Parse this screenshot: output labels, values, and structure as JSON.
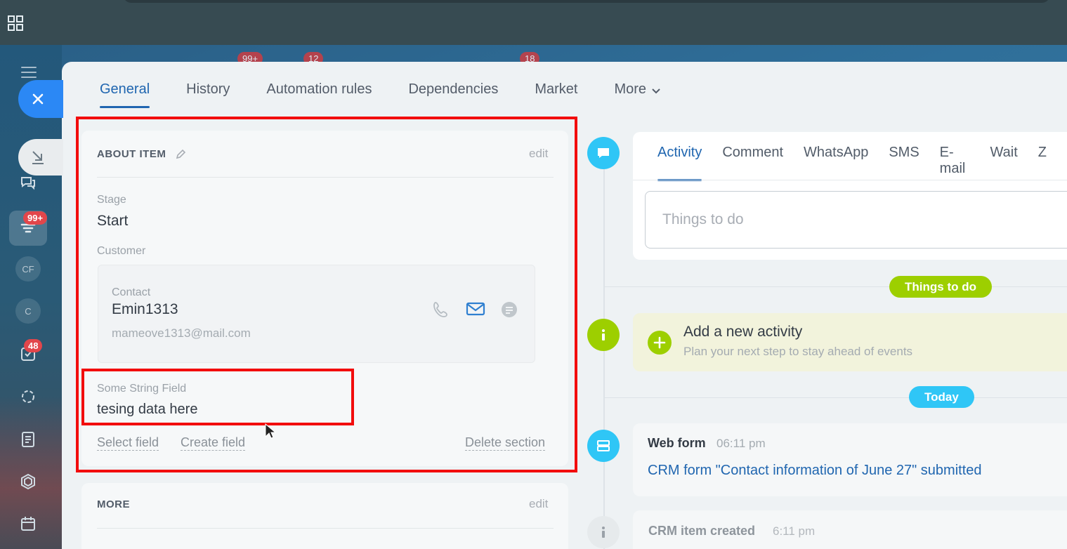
{
  "top_badges": [
    "99+",
    "12",
    "18"
  ],
  "leftnav": {
    "avatars": [
      "CF",
      "C"
    ],
    "badges": {
      "feed": "99+",
      "tasks": "48"
    }
  },
  "tabs": {
    "general": "General",
    "history": "History",
    "automation": "Automation rules",
    "dependencies": "Dependencies",
    "market": "Market",
    "more": "More"
  },
  "about": {
    "title": "ABOUT ITEM",
    "edit": "edit",
    "stage_label": "Stage",
    "stage_value": "Start",
    "customer_label": "Customer",
    "contact_label": "Contact",
    "contact_name": "Emin1313",
    "contact_email": "mameove1313@mail.com",
    "string_field_label": "Some String Field",
    "string_field_value": "tesing data here",
    "select_field": "Select field",
    "create_field": "Create field",
    "delete_section": "Delete section"
  },
  "more_section": {
    "title": "MORE",
    "edit": "edit"
  },
  "editor": {
    "tabs": [
      "Activity",
      "Comment",
      "WhatsApp",
      "SMS",
      "E-mail",
      "Wait",
      "Z"
    ],
    "placeholder": "Things to do"
  },
  "timeline": {
    "things_pill": "Things to do",
    "add_activity_title": "Add a new activity",
    "add_activity_sub": "Plan your next step to stay ahead of events",
    "today_pill": "Today",
    "webform_title": "Web form",
    "webform_time": "06:11 pm",
    "webform_link": "CRM form \"Contact information of June 27\" submitted",
    "crm_title": "CRM item created",
    "crm_time": "6:11 pm"
  },
  "colors": {
    "accent": "#2066b0",
    "highlight": "#f20d0d",
    "green_pill": "#9dcf00",
    "blue_pill": "#2fc6f6"
  }
}
